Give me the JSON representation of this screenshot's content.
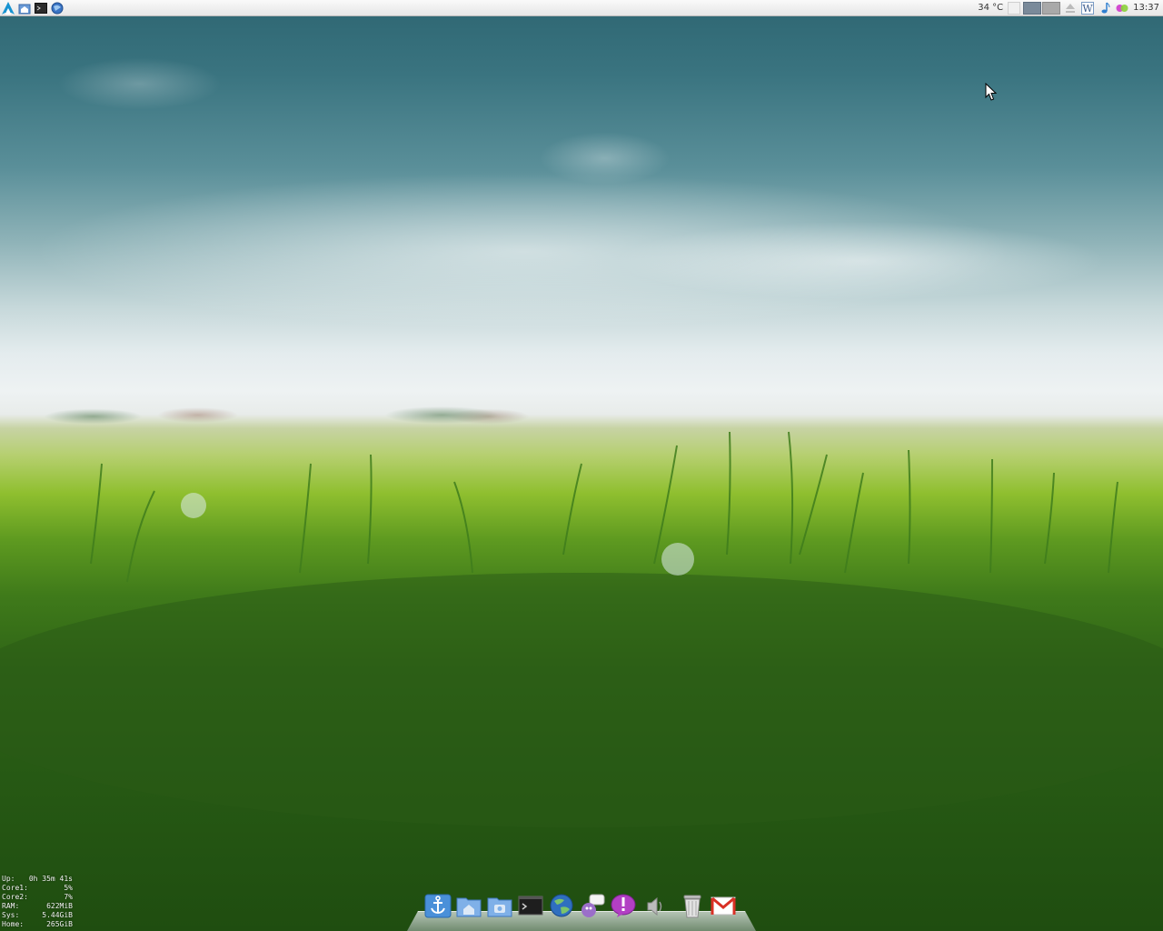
{
  "panel": {
    "launchers": [
      {
        "name": "arch-menu-icon"
      },
      {
        "name": "home-folder-icon"
      },
      {
        "name": "terminal-icon"
      },
      {
        "name": "browser-icon"
      }
    ],
    "temperature": "34 °C",
    "clock": "13:37",
    "pager_desktops": 2
  },
  "conky": [
    {
      "label": "Up:",
      "value": "0h 35m 41s"
    },
    {
      "label": "Core1:",
      "value": "5%"
    },
    {
      "label": "Core2:",
      "value": "7%"
    },
    {
      "label": "RAM:",
      "value": "622MiB"
    },
    {
      "label": "Sys:",
      "value": "5.44GiB"
    },
    {
      "label": "Home:",
      "value": "265GiB"
    }
  ],
  "dock": {
    "items": [
      {
        "name": "anchor-icon"
      },
      {
        "name": "home-folder-icon"
      },
      {
        "name": "pictures-folder-icon"
      },
      {
        "name": "terminal-icon"
      },
      {
        "name": "web-browser-icon"
      },
      {
        "name": "chat-client-icon"
      },
      {
        "name": "notification-icon"
      },
      {
        "name": "volume-icon"
      },
      {
        "name": "trash-icon"
      },
      {
        "name": "gmail-icon"
      }
    ]
  },
  "colors": {
    "panel_bg": "#eeeeee",
    "dock_blue": "#4a90d9",
    "gmail_red": "#d93025"
  }
}
